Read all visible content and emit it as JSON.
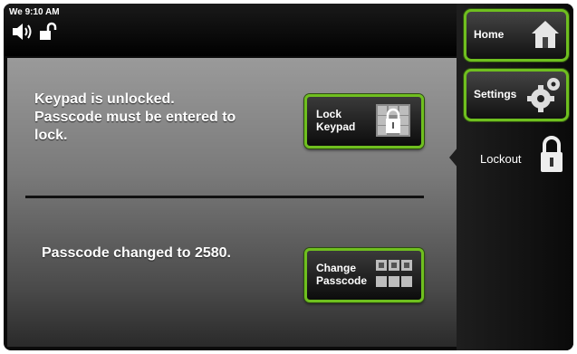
{
  "status_bar": {
    "time": "We 9:10 AM"
  },
  "main": {
    "lock_message": "Keypad is unlocked.\nPasscode must be entered to\nlock.",
    "lock_button": {
      "line1": "Lock",
      "line2": "Keypad"
    },
    "passcode_message": "Passcode changed to 2580.",
    "change_button": {
      "line1": "Change",
      "line2": "Passcode"
    }
  },
  "sidebar": {
    "home_label": "Home",
    "settings_label": "Settings",
    "lockout_label": "Lockout"
  },
  "colors": {
    "accent": "#6fbf1f",
    "panel_top": "#9a9a9a",
    "panel_bottom": "#2a2a2a"
  }
}
